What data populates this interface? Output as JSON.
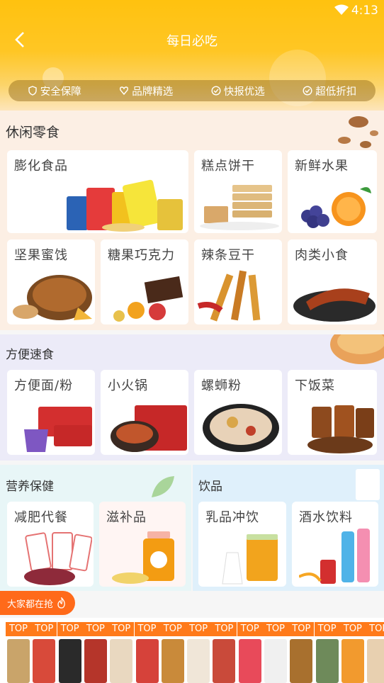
{
  "status": {
    "time": "4:13"
  },
  "header": {
    "title": "每日必吃"
  },
  "badges": [
    "安全保障",
    "品牌精选",
    "快报优选",
    "超低折扣"
  ],
  "sections": {
    "snacks": {
      "title": "休闲零食",
      "items": [
        "膨化食品",
        "糕点饼干",
        "新鲜水果",
        "坚果蜜饯",
        "糖果巧克力",
        "辣条豆干",
        "肉类小食"
      ]
    },
    "instant": {
      "title": "方便速食",
      "items": [
        "方便面/粉",
        "小火锅",
        "螺蛳粉",
        "下饭菜"
      ]
    },
    "health": {
      "title": "营养保健",
      "items": [
        "减肥代餐",
        "滋补品"
      ]
    },
    "drinks": {
      "title": "饮品",
      "items": [
        "乳品冲饮",
        "酒水饮料"
      ]
    }
  },
  "hot": {
    "label": "大家都在抢",
    "tag": "TOP"
  },
  "colors": {
    "accent": "#ffc20f",
    "hot": "#ff6a1a"
  }
}
